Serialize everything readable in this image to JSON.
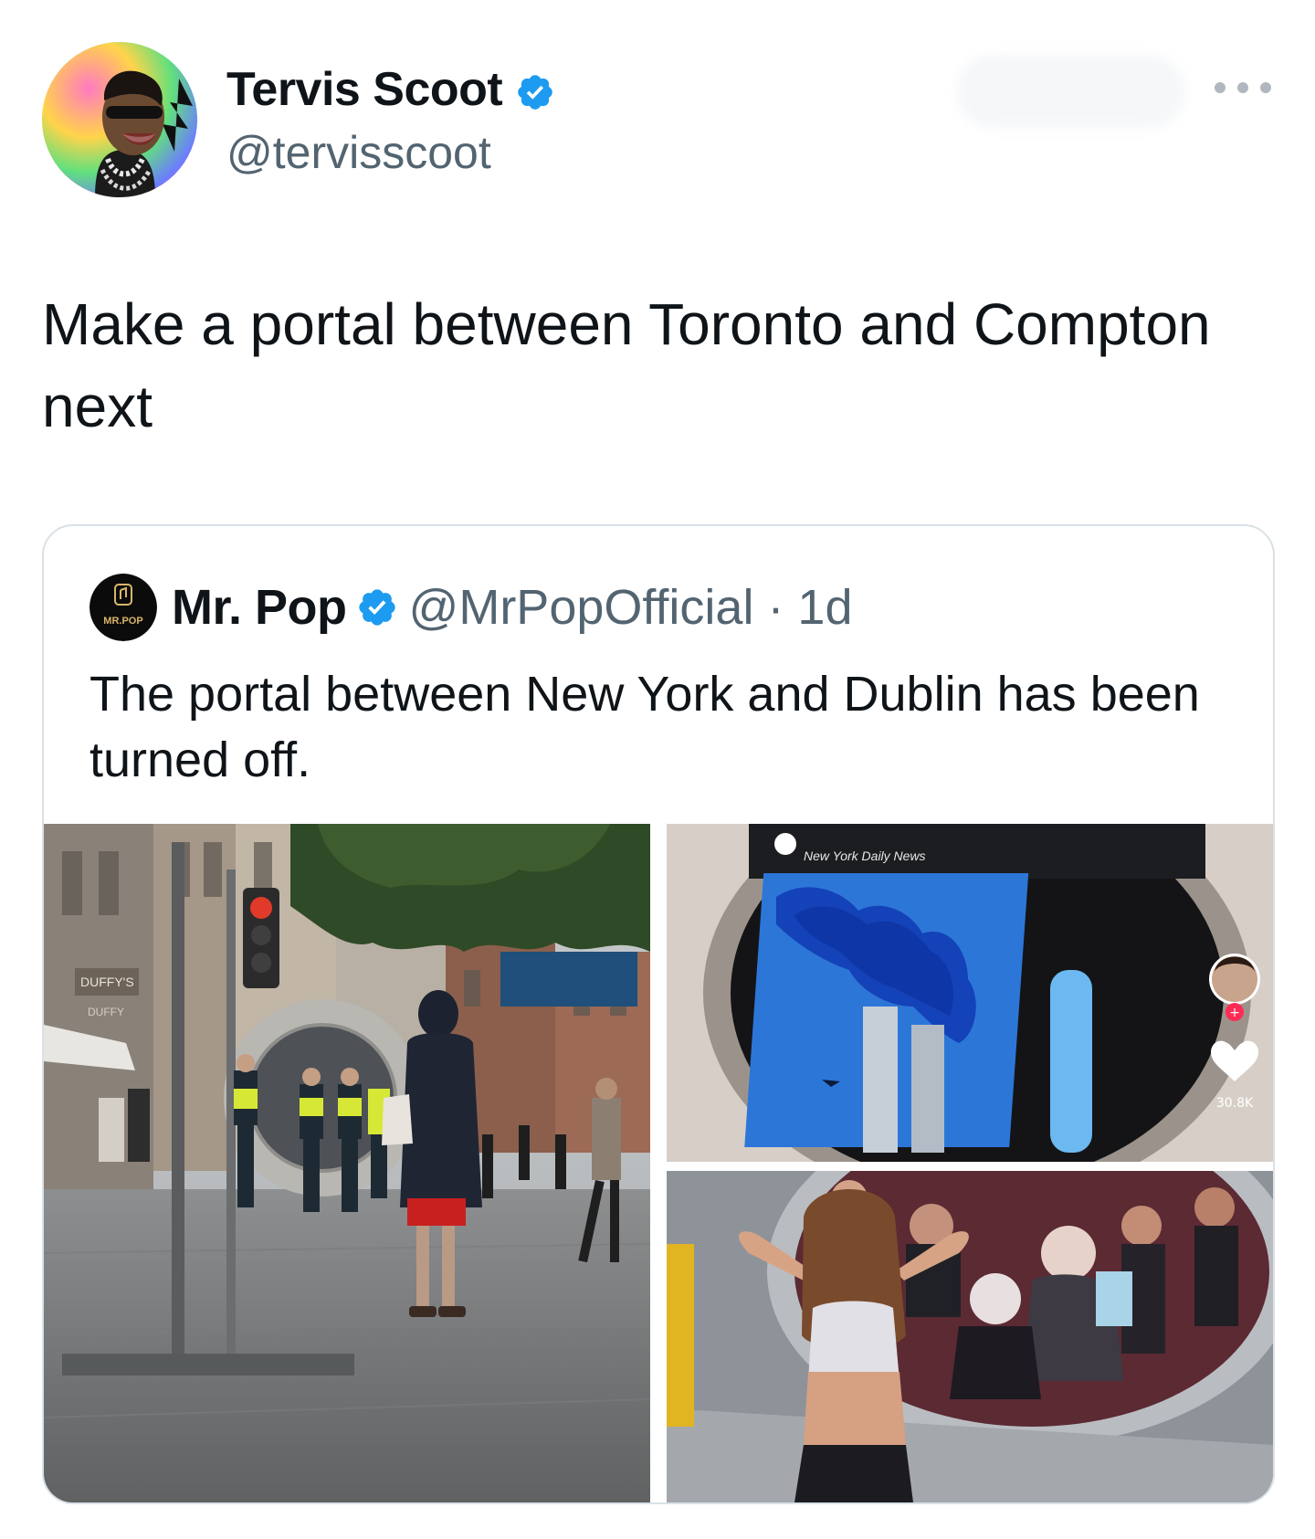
{
  "tweet": {
    "author": {
      "display_name": "Tervis Scoot",
      "handle": "@tervisscoot",
      "verified": true,
      "avatar_icon": "user-avatar"
    },
    "more_icon": "more-horizontal-icon",
    "text": "Make a portal between Toronto and Compton next"
  },
  "quoted_tweet": {
    "author": {
      "display_name": "Mr. Pop",
      "handle_time": "@MrPopOfficial · 1d",
      "verified": true,
      "avatar_label": "MR.POP"
    },
    "text": "The portal between New York and Dublin has been turned off.",
    "media": [
      {
        "name": "dublin-street-photo",
        "signs": {
          "shop": "DUFFY'S",
          "shop_sub": "DUFFY"
        }
      },
      {
        "name": "portal-screen-photo",
        "overlay_text": "New York Daily News",
        "likes": "30.8K"
      },
      {
        "name": "portal-dancer-photo"
      }
    ]
  },
  "colors": {
    "verified": "#1d9bf0",
    "handle": "#536471",
    "border": "#d9e1e7"
  }
}
